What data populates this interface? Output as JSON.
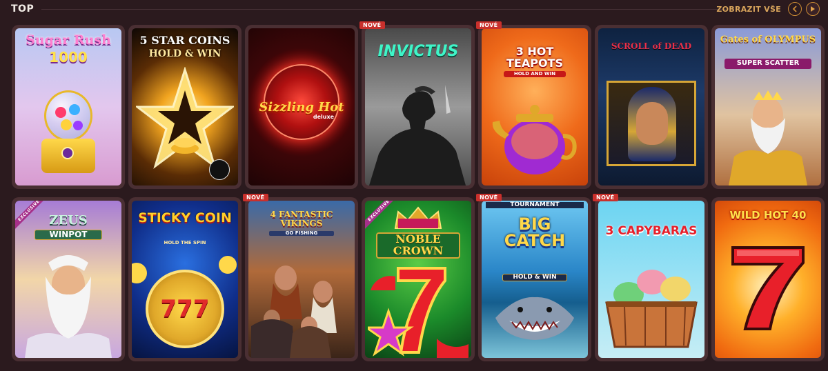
{
  "header": {
    "title": "TOP",
    "show_all": "ZOBRAZIT VŠE"
  },
  "colors": {
    "background": "#2b1a1e",
    "tile_frame": "#4a2f33",
    "accent": "#d9a55c",
    "new_badge": "#c9302c",
    "exclusive_ribbon": "#a6308a"
  },
  "icons": {
    "prev": "arrow-left-icon",
    "next": "arrow-right-icon"
  },
  "games": [
    {
      "title_line1": "Sugar Rush",
      "title_line2": "1000",
      "badge": ""
    },
    {
      "title_line1": "5 STAR COINS",
      "title_line2": "HOLD & WIN",
      "badge": ""
    },
    {
      "title_line1": "Sizzling Hot",
      "title_line2": "deluxe",
      "badge": ""
    },
    {
      "title_line1": "INVICTUS",
      "title_line2": "",
      "badge": "NOVÉ"
    },
    {
      "title_line1": "3 HOT TEAPOTS",
      "title_line2": "HOLD AND WIN",
      "badge": "NOVÉ"
    },
    {
      "title_line1": "SCROLL of DEAD",
      "title_line2": "",
      "badge": ""
    },
    {
      "title_line1": "Gates of OLYMPUS",
      "title_line2": "SUPER SCATTER",
      "badge": ""
    },
    {
      "title_line1": "ZEUS",
      "title_line2": "WINPOT",
      "ribbon": "EXCLUSIVE"
    },
    {
      "title_line1": "STICKY COIN",
      "title_line2": "HOLD THE SPIN",
      "badge": ""
    },
    {
      "title_line1": "4 FANTASTIC VIKINGS",
      "title_line2": "GO FISHING",
      "badge": "NOVÉ"
    },
    {
      "title_line1": "NOBLE CROWN",
      "title_line2": "",
      "ribbon": "EXCLUSIVE"
    },
    {
      "title_line0": "TOURNAMENT",
      "title_line1": "BIG CATCH",
      "title_line2": "HOLD & WIN",
      "badge": "NOVÉ"
    },
    {
      "title_line1": "3 CAPYBARAS",
      "title_line2": "",
      "badge": "NOVÉ"
    },
    {
      "title_line1": "WILD HOT 40",
      "title_line2": "",
      "badge": ""
    }
  ]
}
